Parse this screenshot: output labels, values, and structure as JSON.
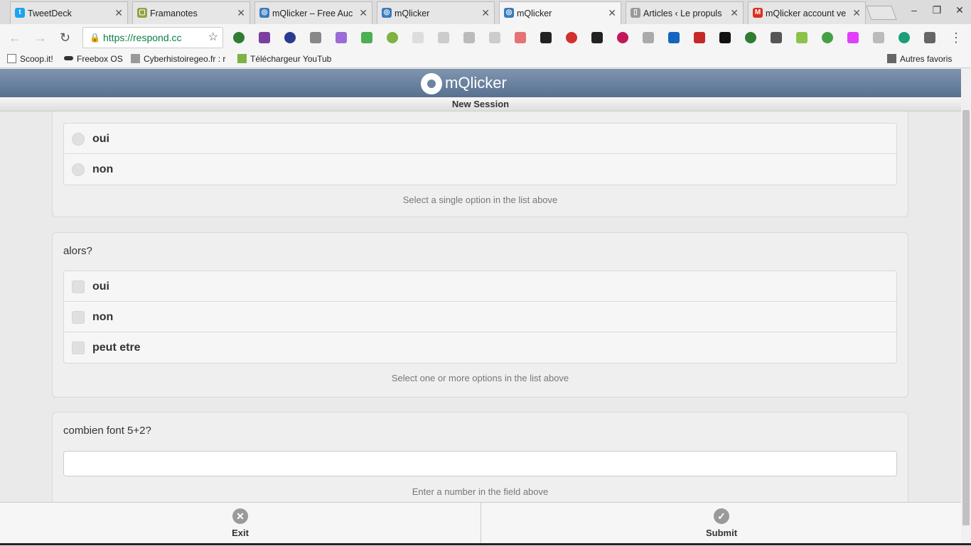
{
  "browser": {
    "tabs": [
      {
        "title": "TweetDeck",
        "icon": "twitter-icon",
        "color": "#1da1f2"
      },
      {
        "title": "Framanotes",
        "icon": "framanotes-icon",
        "color": "#8fa543"
      },
      {
        "title": "mQlicker – Free Auc",
        "icon": "mqlicker-icon",
        "color": "#3a7bbf"
      },
      {
        "title": "mQlicker",
        "icon": "mqlicker-icon",
        "color": "#3a7bbf"
      },
      {
        "title": "mQlicker",
        "icon": "mqlicker-icon",
        "color": "#3a7bbf",
        "active": true
      },
      {
        "title": "Articles ‹ Le propuls",
        "icon": "page-icon",
        "color": "#999999"
      },
      {
        "title": "mQlicker account ve",
        "icon": "gmail-icon",
        "color": "#d93025"
      }
    ],
    "url": "https://respond.cc",
    "bookmarks": [
      {
        "label": "Scoop.it!"
      },
      {
        "label": "Freebox OS"
      },
      {
        "label": "Cyberhistoiregeo.fr : r"
      },
      {
        "label": "Téléchargeur YouTub"
      }
    ],
    "other_bookmarks": "Autres favoris"
  },
  "app": {
    "logo_text": "mQlicker",
    "session_title": "New Session"
  },
  "questions": [
    {
      "type": "single",
      "options": [
        "oui",
        "non"
      ],
      "hint": "Select a single option in the list above"
    },
    {
      "type": "multiple",
      "question": "alors?",
      "options": [
        "oui",
        "non",
        "peut etre"
      ],
      "hint": "Select one or more options in the list above"
    },
    {
      "type": "number",
      "question": "combien font 5+2?",
      "value": "",
      "hint": "Enter a number in the field above"
    }
  ],
  "footer": {
    "exit_label": "Exit",
    "submit_label": "Submit"
  }
}
